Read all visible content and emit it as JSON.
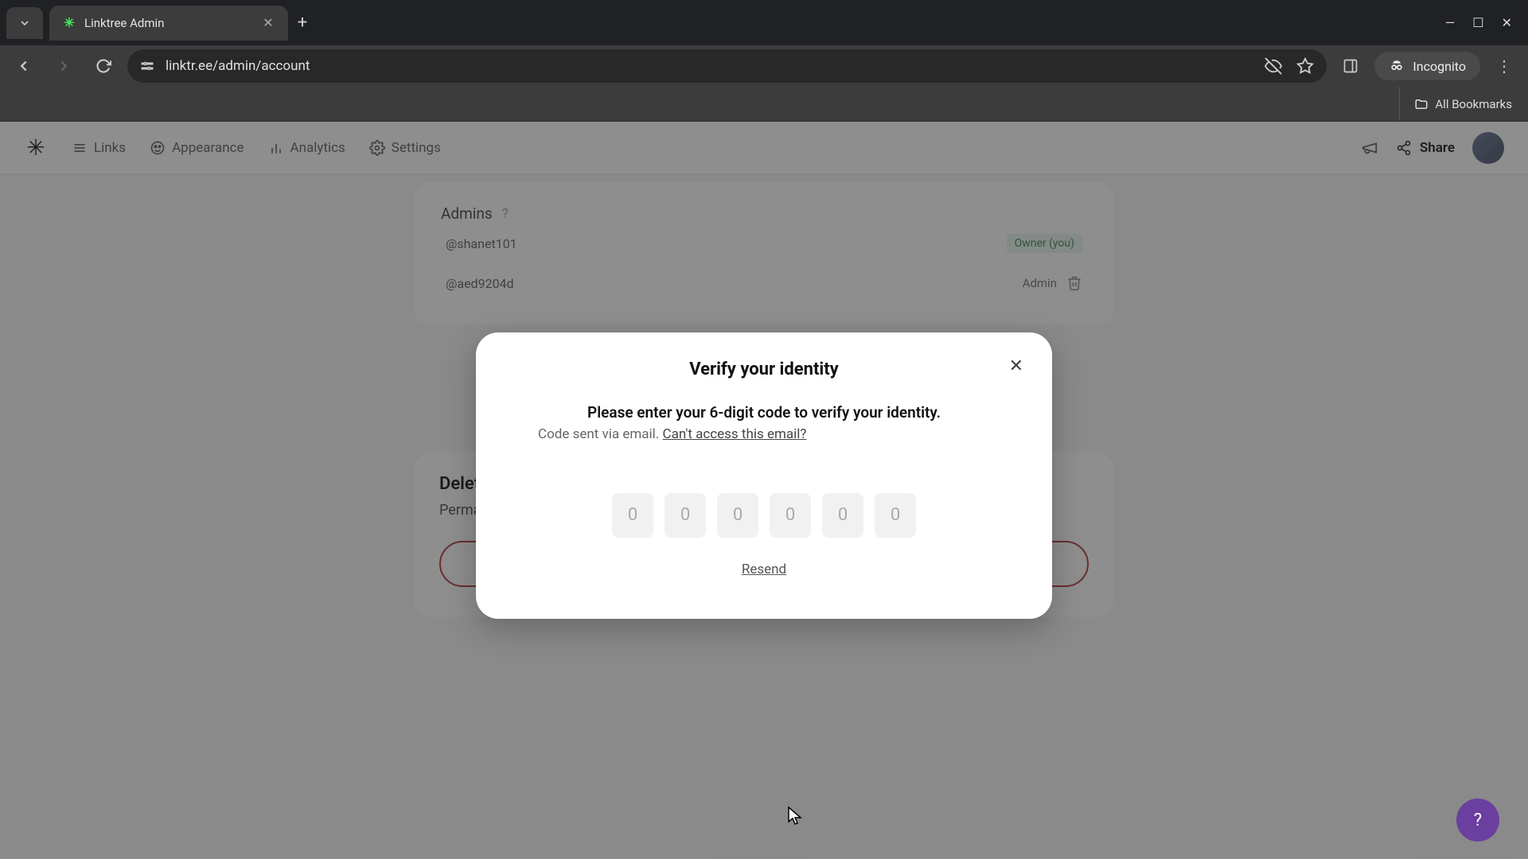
{
  "browser": {
    "tab_title": "Linktree Admin",
    "url": "linktr.ee/admin/account",
    "incognito_label": "Incognito",
    "all_bookmarks": "All Bookmarks"
  },
  "header": {
    "nav": {
      "links": "Links",
      "appearance": "Appearance",
      "analytics": "Analytics",
      "settings": "Settings"
    },
    "share": "Share"
  },
  "page": {
    "admins_title": "Admins",
    "admins": [
      {
        "handle": "@shanet101",
        "role_label": "Owner (you)",
        "role": "owner"
      },
      {
        "handle": "@aed9204d",
        "role_label": "Admin",
        "role": "admin"
      }
    ],
    "delete_heading": "Delete",
    "delete_sub": "Perma"
  },
  "modal": {
    "title": "Verify your identity",
    "instruction": "Please enter your 6-digit code to verify your identity.",
    "sent_prefix": "Code sent via email. ",
    "cant_access": "Can't access this email?",
    "code_placeholder": "0",
    "resend": "Resend"
  },
  "help_fab": "?"
}
